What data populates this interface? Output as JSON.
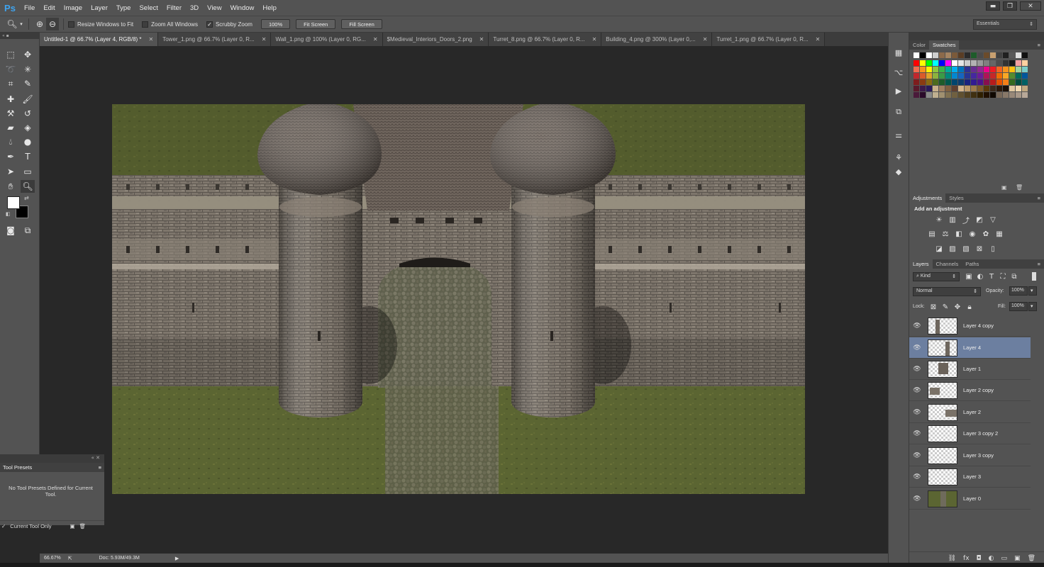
{
  "app": {
    "logo": "Ps"
  },
  "menu": [
    "File",
    "Edit",
    "Image",
    "Layer",
    "Type",
    "Select",
    "Filter",
    "3D",
    "View",
    "Window",
    "Help"
  ],
  "window_controls": {
    "minimize": "▬",
    "restore": "❐",
    "close": "✕"
  },
  "options": {
    "resize_windows": {
      "label": "Resize Windows to Fit",
      "checked": false
    },
    "zoom_all": {
      "label": "Zoom All Windows",
      "checked": false
    },
    "scrubby_zoom": {
      "label": "Scrubby Zoom",
      "checked": true
    },
    "btn_100": "100%",
    "btn_fit": "Fit Screen",
    "btn_fill": "Fill Screen",
    "workspace": "Essentials"
  },
  "tabs": [
    {
      "label": "Untitled-1 @ 66.7% (Layer 4, RGB/8) *",
      "active": true
    },
    {
      "label": "Tower_1.png @ 66.7% (Layer 0, R...",
      "active": false
    },
    {
      "label": "Wall_1.png @ 100% (Layer 0, RG...",
      "active": false
    },
    {
      "label": "$Medieval_Interiors_Doors_2.png",
      "active": false
    },
    {
      "label": "Turret_8.png @ 66.7% (Layer 0, R...",
      "active": false
    },
    {
      "label": "Building_4.png @ 300% (Layer 0,...",
      "active": false
    },
    {
      "label": "Turret_1.png @ 66.7% (Layer 0, R...",
      "active": false
    }
  ],
  "tab_close": "✕",
  "status": {
    "zoom": "66.67%",
    "doc": "Doc: 5.93M/49.3M"
  },
  "tool_presets": {
    "tab": "Tool Presets",
    "empty": "No Tool Presets Defined for Current Tool.",
    "current_only": "Current Tool Only"
  },
  "color_panel": {
    "tabs": [
      "Color",
      "Swatches"
    ]
  },
  "adjustments": {
    "tabs": [
      "Adjustments",
      "Styles"
    ],
    "title": "Add an adjustment"
  },
  "layers_panel": {
    "tabs": [
      "Layers",
      "Channels",
      "Paths"
    ],
    "kind": "Kind",
    "blend": "Normal",
    "opacity_label": "Opacity:",
    "opacity": "100%",
    "lock_label": "Lock:",
    "fill_label": "Fill:",
    "fill": "100%",
    "layers": [
      "Layer 4 copy",
      "Layer 4",
      "Layer 1",
      "Layer 2 copy",
      "Layer 2",
      "Layer 3 copy 2",
      "Layer 3 copy",
      "Layer 3",
      "Layer 0"
    ],
    "selected": "Layer 4"
  },
  "colors": {
    "ui_bg": "#535353",
    "canvas_bg": "#282828",
    "selected_layer": "#6c7fa0",
    "ps_blue": "#3fa4ef",
    "grass": "#5b6532",
    "stone": "#8c8276",
    "path": "#6f6b5c"
  }
}
